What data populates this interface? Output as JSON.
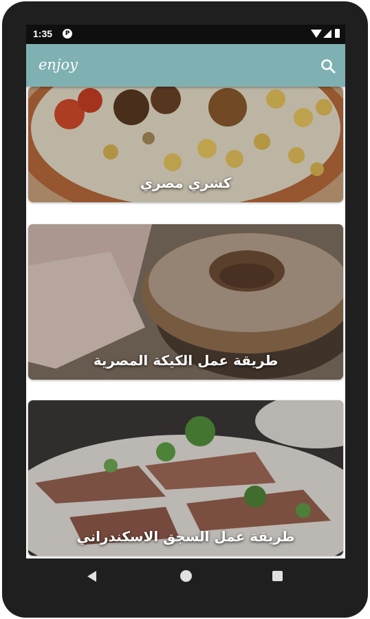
{
  "status_bar": {
    "time": "1:35",
    "app_icon": "notification-app-icon",
    "icons": [
      "wifi-icon",
      "signal-icon",
      "battery-icon"
    ]
  },
  "app_bar": {
    "title": "enjoy",
    "color": "#7fb1b2",
    "search_icon": "search-icon"
  },
  "recipes": [
    {
      "title": "كشري مصري",
      "image": "koshari-photo"
    },
    {
      "title": "طريقة عمل الكيكة المصرية",
      "image": "egyptian-cake-photo"
    },
    {
      "title": "طريقة عمل السجق الاسكندراني",
      "image": "alexandrian-sausage-photo"
    }
  ],
  "nav_bar": {
    "icons": [
      "back-icon",
      "home-icon",
      "recents-icon"
    ]
  }
}
